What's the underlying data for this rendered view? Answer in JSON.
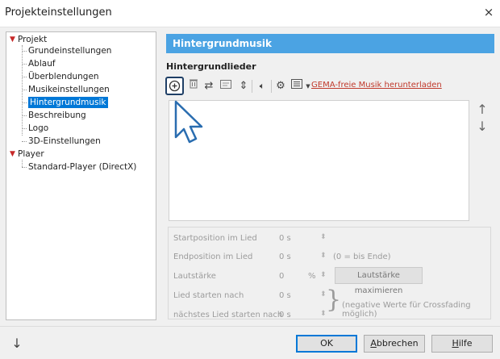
{
  "window": {
    "title": "Projekteinstellungen",
    "close_glyph": "×"
  },
  "tree": {
    "root1": "Projekt",
    "children1": [
      "Grundeinstellungen",
      "Ablauf",
      "Überblendungen",
      "Musikeinstellungen",
      "Hintergrundmusik",
      "Beschreibung",
      "Logo",
      "3D-Einstellungen"
    ],
    "root2": "Player",
    "children2": [
      "Standard-Player (DirectX)"
    ],
    "selected": "Hintergrundmusik"
  },
  "panel": {
    "header": "Hintergrundmusik",
    "section": "Hintergrundlieder",
    "toolbar": {
      "icons": [
        "add-circle-icon",
        "delete-icon",
        "swap-icon",
        "properties-icon",
        "sort-icon",
        "volume-icon",
        "gear-icon",
        "view-menu-icon",
        "dropdown-arrow-icon"
      ],
      "download_link": "GEMA-freie Musik herunterladen"
    },
    "list_side_buttons": {
      "up": "↑",
      "down": "↓"
    }
  },
  "properties": {
    "start_label": "Startposition im Lied",
    "start_value": "0 s",
    "end_label": "Endposition im Lied",
    "end_value": "0 s",
    "end_note": "(0 = bis Ende)",
    "volume_label": "Lautstärke",
    "volume_value": "0",
    "volume_unit": "%",
    "maximize_button": "Lautstärke maximieren",
    "song_start_label": "Lied starten nach",
    "song_start_value": "0 s",
    "next_start_label": "nächstes Lied starten nach",
    "next_start_value": "0 s",
    "crossfade_note": "(negative Werte für Crossfading möglich)"
  },
  "footer": {
    "down_arrow": "↓",
    "ok": "OK",
    "cancel": "Abbrechen",
    "help": "Hilfe"
  },
  "colors": {
    "header_bg": "#4ba3e3",
    "selection": "#0078d7",
    "link": "#c0392b",
    "tree_caret": "#c62828"
  }
}
